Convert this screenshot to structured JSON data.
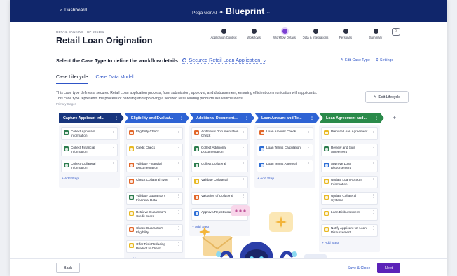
{
  "header": {
    "back_label": "Dashboard",
    "brand_prefix": "Pega GenAI",
    "brand_name": "Blueprint",
    "brand_tm": "™"
  },
  "page": {
    "breadcrumb": "RETAIL BANKING - BP-206181",
    "title": "Retail Loan Origination"
  },
  "progress": {
    "steps": [
      {
        "label": "Application Context",
        "state": "done"
      },
      {
        "label": "Workflows",
        "state": "done"
      },
      {
        "label": "Workflow Details",
        "state": "active"
      },
      {
        "label": "Data & Integrations",
        "state": "todo"
      },
      {
        "label": "Personas",
        "state": "todo"
      },
      {
        "label": "Summary",
        "state": "todo"
      }
    ]
  },
  "case_type": {
    "prompt": "Select the Case Type to define the workflow details:",
    "selected": "Secured Retail Loan Application",
    "edit_label": "Edit Case Type",
    "settings_label": "Settings"
  },
  "tabs": [
    {
      "label": "Case Lifecycle",
      "active": true
    },
    {
      "label": "Case Data Model",
      "active": false
    }
  ],
  "description": {
    "line1": "This case type defines a secured Retail Loan application process, from submission, approval, and disbursement, ensuring efficient communication with applicants.",
    "line2": "This case type represents the process of handling and approving a secured retail lending products like vehicle loans.",
    "caption": "Primary Stages",
    "edit_button": "Edit Lifecycle"
  },
  "stages": [
    {
      "name": "Capture Applicant Inf...",
      "color": "#17357d",
      "steps": [
        {
          "label": "Collect Applicant Information",
          "icon": "form-icon",
          "color": "green"
        },
        {
          "label": "Collect Financial Information",
          "icon": "form-icon",
          "color": "green"
        },
        {
          "label": "Collect Collateral Information",
          "icon": "form-icon",
          "color": "green"
        }
      ],
      "add_label": "Add Step"
    },
    {
      "name": "Eligibility and Evaluat...",
      "color": "#2e63d4",
      "steps": [
        {
          "label": "Eligibility Check",
          "icon": "automation-icon",
          "color": "orange"
        },
        {
          "label": "Credit Check",
          "icon": "decision-icon",
          "color": "yellow"
        },
        {
          "label": "Validate Financial Documentation",
          "icon": "automation-icon",
          "color": "orange"
        },
        {
          "label": "Check Collateral Type",
          "icon": "automation-icon",
          "color": "orange"
        },
        {
          "label": "Validate Guarantor's Financial Data",
          "icon": "form-icon",
          "color": "green"
        },
        {
          "label": "Retrieve Guarantor's Credit Score",
          "icon": "decision-icon",
          "color": "yellow"
        },
        {
          "label": "Check Guarantor's Eligibility",
          "icon": "automation-icon",
          "color": "orange"
        },
        {
          "label": "Offer Risk Reducing Product to Client",
          "icon": "decision-icon",
          "color": "yellow"
        }
      ],
      "add_label": "Add Step"
    },
    {
      "name": "Additional Document...",
      "color": "#2e63d4",
      "steps": [
        {
          "label": "Additional Documentation Check",
          "icon": "automation-icon",
          "color": "orange"
        },
        {
          "label": "Collect Additional Documentation",
          "icon": "form-icon",
          "color": "green"
        },
        {
          "label": "Collect Collateral",
          "icon": "form-icon",
          "color": "green"
        },
        {
          "label": "Validate Collateral",
          "icon": "decision-icon",
          "color": "yellow"
        },
        {
          "label": "Valuation of Collateral",
          "icon": "automation-icon",
          "color": "orange"
        },
        {
          "label": "Approve/Reject Loan",
          "icon": "approval-icon",
          "color": "blue"
        }
      ],
      "add_label": "Add Step"
    },
    {
      "name": "Loan Amount and Te...",
      "color": "#2e63d4",
      "steps": [
        {
          "label": "Loan Amount Check",
          "icon": "automation-icon",
          "color": "orange"
        },
        {
          "label": "Loan Terms Calculation",
          "icon": "approval-icon",
          "color": "blue"
        },
        {
          "label": "Loan Terms Approval",
          "icon": "approval-icon",
          "color": "blue"
        }
      ],
      "add_label": "Add Step"
    },
    {
      "name": "Loan Agreement and ...",
      "color": "#2a8a4a",
      "steps": [
        {
          "label": "Prepare Loan Agreement",
          "icon": "decision-icon",
          "color": "yellow"
        },
        {
          "label": "Review and Sign Agreement",
          "icon": "form-icon",
          "color": "green"
        },
        {
          "label": "Approve Loan Disbursement",
          "icon": "approval-icon",
          "color": "blue"
        },
        {
          "label": "Update Loan Account Information",
          "icon": "decision-icon",
          "color": "yellow"
        },
        {
          "label": "Update Collateral Systems",
          "icon": "decision-icon",
          "color": "yellow"
        },
        {
          "label": "Loan Disbursement",
          "icon": "decision-icon",
          "color": "yellow"
        },
        {
          "label": "Notify Applicant for Loan Disbursement",
          "icon": "decision-icon",
          "color": "yellow"
        }
      ],
      "add_label": "Add Step"
    }
  ],
  "footer": {
    "back_label": "Back",
    "save_label": "Save & Close",
    "next_label": "Next"
  }
}
